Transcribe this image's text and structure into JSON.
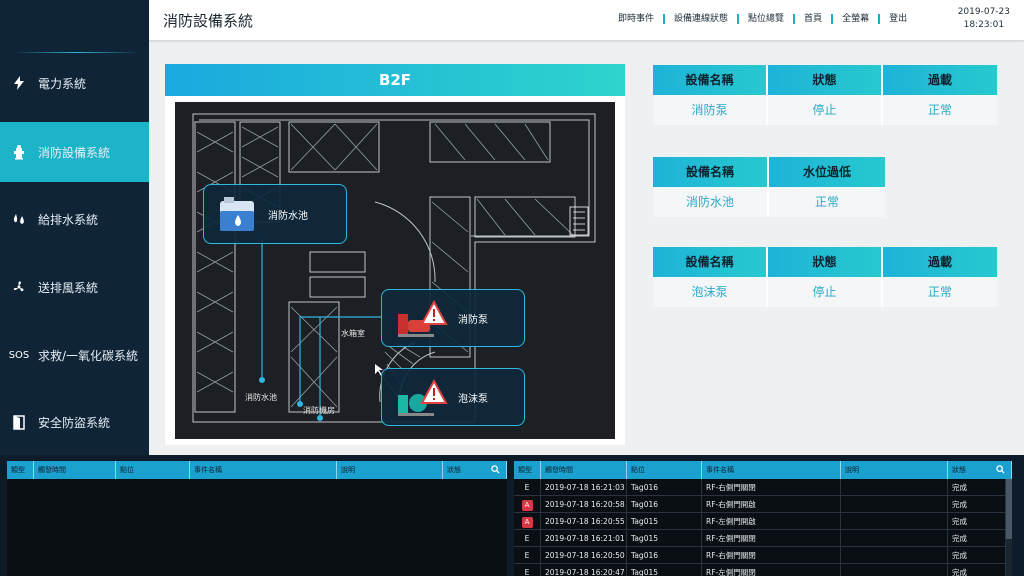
{
  "header": {
    "title": "消防設備系統",
    "nav": [
      "即時事件",
      "設備連線狀態",
      "點位總覽",
      "首頁",
      "全螢幕",
      "登出"
    ],
    "date": "2019-07-23",
    "time": "18:23:01"
  },
  "sidebar": {
    "items": [
      {
        "label": "電力系統",
        "icon": "lightning-icon",
        "active": false
      },
      {
        "label": "消防設備系統",
        "icon": "fire-hydrant-icon",
        "active": true
      },
      {
        "label": "給排水系統",
        "icon": "water-drops-icon",
        "active": false
      },
      {
        "label": "送排風系統",
        "icon": "fan-icon",
        "active": false
      },
      {
        "label": "求救/一氧化碳系統",
        "icon": "sos-icon",
        "active": false
      },
      {
        "label": "安全防盜系統",
        "icon": "door-icon",
        "active": false
      }
    ],
    "sos_text": "SOS"
  },
  "floor": {
    "title": "B2F",
    "callouts": {
      "tank": "消防水池",
      "fire_pump": "消防泵",
      "foam_pump": "泡沫泵"
    },
    "labels": {
      "water_room": "水箱室",
      "tank_small": "消防水池",
      "pump_room": "消防機房"
    }
  },
  "status_tables": [
    {
      "headers": [
        "設備名稱",
        "狀態",
        "過載"
      ],
      "values": [
        "消防泵",
        "停止",
        "正常"
      ]
    },
    {
      "headers": [
        "設備名稱",
        "水位過低"
      ],
      "values": [
        "消防水池",
        "正常"
      ]
    },
    {
      "headers": [
        "設備名稱",
        "狀態",
        "過載"
      ],
      "values": [
        "泡沫泵",
        "停止",
        "正常"
      ]
    }
  ],
  "events_left": {
    "headers": [
      "類型",
      "觸發時間",
      "點位",
      "事件名稱",
      "說明",
      "狀態"
    ]
  },
  "events_right": {
    "headers": [
      "類型",
      "觸發時間",
      "點位",
      "事件名稱",
      "說明",
      "狀態"
    ],
    "rows": [
      {
        "type": "E",
        "alarm": false,
        "time": "2019-07-18 16:21:03",
        "tag": "Tag016",
        "name": "RF-右側門關閉",
        "desc": "",
        "status": "完成"
      },
      {
        "type": "A",
        "alarm": true,
        "time": "2019-07-18 16:20:58",
        "tag": "Tag016",
        "name": "RF-右側門開啟",
        "desc": "",
        "status": "完成"
      },
      {
        "type": "A",
        "alarm": true,
        "time": "2019-07-18 16:20:55",
        "tag": "Tag015",
        "name": "RF-左側門開啟",
        "desc": "",
        "status": "完成"
      },
      {
        "type": "E",
        "alarm": false,
        "time": "2019-07-18 16:21:01",
        "tag": "Tag015",
        "name": "RF-左側門關閉",
        "desc": "",
        "status": "完成"
      },
      {
        "type": "E",
        "alarm": false,
        "time": "2019-07-18 16:20:50",
        "tag": "Tag016",
        "name": "RF-右側門關閉",
        "desc": "",
        "status": "完成"
      },
      {
        "type": "E",
        "alarm": false,
        "time": "2019-07-18 16:20:47",
        "tag": "Tag015",
        "name": "RF-左側門關閉",
        "desc": "",
        "status": "完成"
      }
    ]
  },
  "colors": {
    "accent": "#1db3c9",
    "sidebar_bg": "#0f2436",
    "alarm": "#d33a46",
    "callout_border": "#32b8e0"
  }
}
